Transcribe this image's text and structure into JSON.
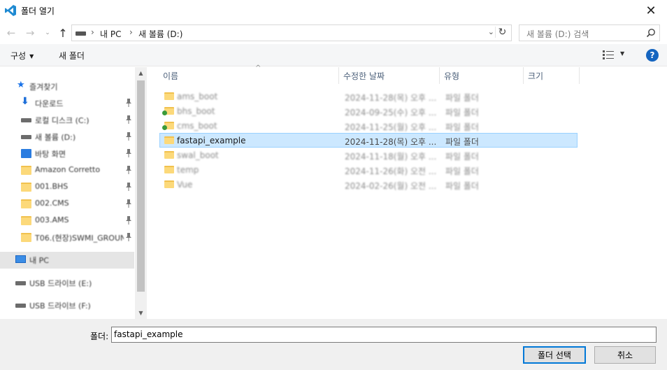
{
  "window": {
    "title": "폴더 열기",
    "icon": "vscode-icon",
    "close_glyph": "✕"
  },
  "nav": {
    "back_glyph": "←",
    "forward_glyph": "→",
    "recent_glyph": "⌄",
    "up_glyph": "↑",
    "breadcrumb": [
      "내 PC",
      "새 볼륨 (D:)"
    ],
    "crumb_sep": "›",
    "dropdown_glyph": "⌄",
    "refresh_glyph": "↻",
    "search_placeholder": "새 볼륨 (D:) 검색"
  },
  "toolbar": {
    "organize_label": "구성",
    "new_folder_label": "새 폴더",
    "caret_glyph": "▼",
    "help_glyph": "?"
  },
  "navpane": {
    "items": [
      {
        "label": "즐겨찾기",
        "icon": "star-icon",
        "pinned": false
      },
      {
        "label": "다운로드",
        "icon": "download-icon",
        "pinned": true
      },
      {
        "label": "로컬 디스크 (C:)",
        "icon": "disk-icon",
        "pinned": true
      },
      {
        "label": "새 볼륨 (D:)",
        "icon": "disk-icon",
        "pinned": true
      },
      {
        "label": "바탕 화면",
        "icon": "desktop-icon",
        "pinned": true
      },
      {
        "label": "Amazon Corretto",
        "icon": "folder-icon",
        "pinned": true
      },
      {
        "label": "001.BHS",
        "icon": "folder-icon",
        "pinned": true
      },
      {
        "label": "002.CMS",
        "icon": "folder-icon",
        "pinned": true
      },
      {
        "label": "003.AMS",
        "icon": "folder-icon",
        "pinned": true
      },
      {
        "label": "T06.(현장)SWMI_GROUN",
        "icon": "folder-icon",
        "pinned": true
      },
      {
        "label": "내 PC",
        "icon": "pc-icon",
        "pinned": false,
        "selected": true
      },
      {
        "label": "USB 드라이브 (E:)",
        "icon": "disk-icon",
        "pinned": false
      },
      {
        "label": "USB 드라이브 (F:)",
        "icon": "disk-icon",
        "pinned": false
      }
    ],
    "scroll_up_glyph": "▲",
    "scroll_down_glyph": "▼"
  },
  "columns": {
    "name": "이름",
    "modified": "수정한 날짜",
    "type": "유형",
    "size": "크기",
    "sort_glyph": "^"
  },
  "files": [
    {
      "name": "ams_boot",
      "date": "2024-11-28(목) 오후 ...",
      "type": "파일 폴더",
      "badge": false,
      "blurred": true
    },
    {
      "name": "bhs_boot",
      "date": "2024-09-25(수) 오후 ...",
      "type": "파일 폴더",
      "badge": true,
      "blurred": true
    },
    {
      "name": "cms_boot",
      "date": "2024-11-25(월) 오후 ...",
      "type": "파일 폴더",
      "badge": true,
      "blurred": true
    },
    {
      "name": "fastapi_example",
      "date": "2024-11-28(목) 오후 ...",
      "type": "파일 폴더",
      "badge": false,
      "blurred": false,
      "selected": true
    },
    {
      "name": "swal_boot",
      "date": "2024-11-18(월) 오후 ...",
      "type": "파일 폴더",
      "badge": false,
      "blurred": true
    },
    {
      "name": "temp",
      "date": "2024-11-26(화) 오전 ...",
      "type": "파일 폴더",
      "badge": false,
      "blurred": true
    },
    {
      "name": "Vue",
      "date": "2024-02-26(월) 오전 ...",
      "type": "파일 폴더",
      "badge": false,
      "blurred": true
    }
  ],
  "footer": {
    "folder_label": "폴더:",
    "folder_value": "fastapi_example",
    "select_button": "폴더 선택",
    "cancel_button": "취소"
  },
  "colors": {
    "selection_bg": "#cce8ff",
    "selection_border": "#99d1ff",
    "primary_border": "#0078d7",
    "help_bg": "#1565c0"
  }
}
